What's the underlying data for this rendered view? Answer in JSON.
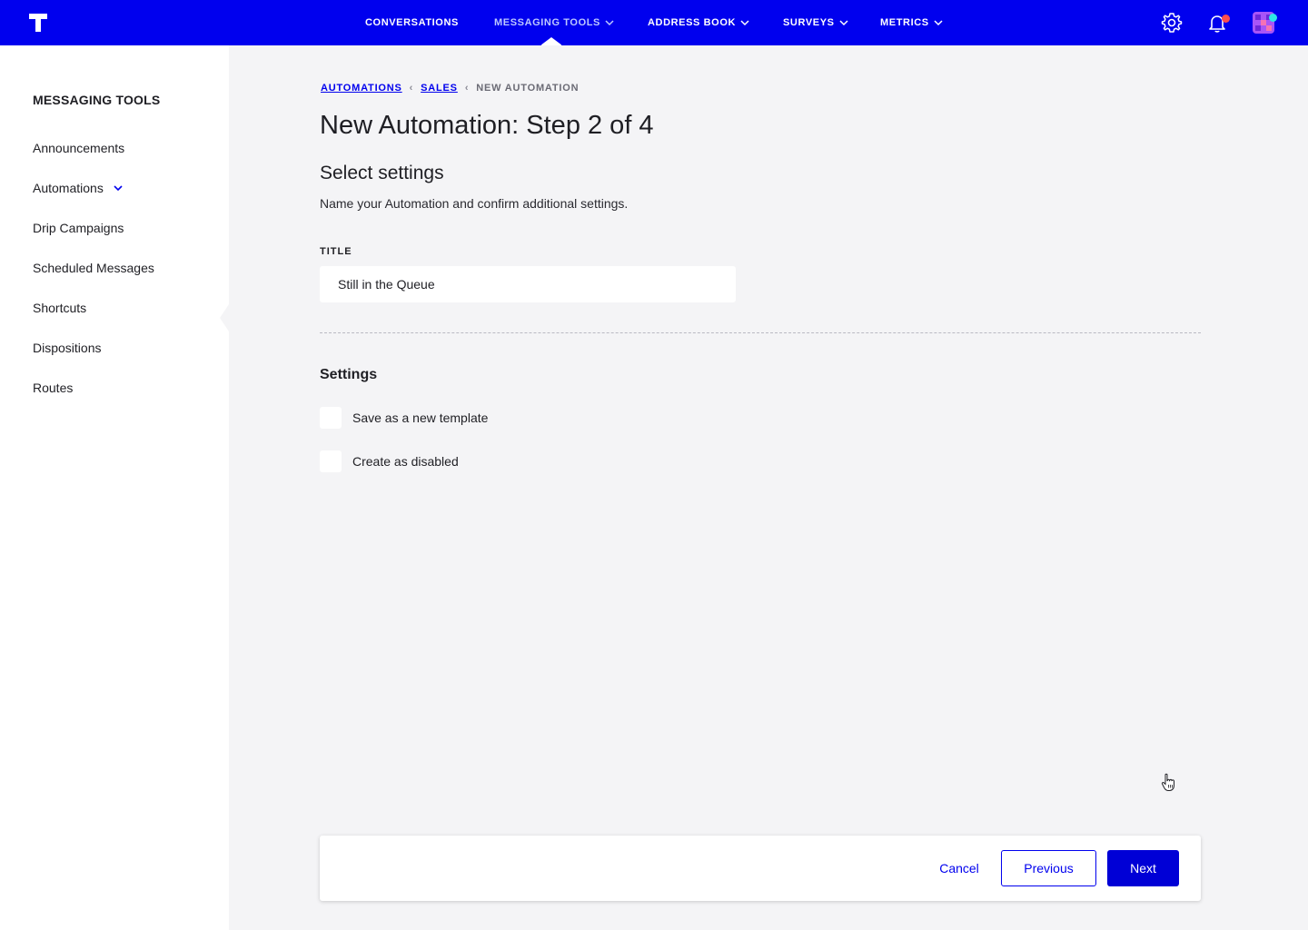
{
  "nav": {
    "items": [
      {
        "label": "CONVERSATIONS",
        "dropdown": false,
        "active": false
      },
      {
        "label": "MESSAGING TOOLS",
        "dropdown": true,
        "active": true
      },
      {
        "label": "ADDRESS BOOK",
        "dropdown": true,
        "active": false
      },
      {
        "label": "SURVEYS",
        "dropdown": true,
        "active": false
      },
      {
        "label": "METRICS",
        "dropdown": true,
        "active": false
      }
    ],
    "icons": [
      "settings-gear-icon",
      "notification-bell-icon",
      "user-avatar-icon"
    ],
    "notification_dot_color": "#ff4d4d",
    "avatar_dot_color": "#2ee6e6"
  },
  "colors": {
    "brand": "#0000ee",
    "active_nav": "#bdc9ff",
    "background": "#f4f4f6"
  },
  "sidebar": {
    "title": "MESSAGING TOOLS",
    "items": [
      {
        "label": "Announcements"
      },
      {
        "label": "Automations",
        "expandable": true
      },
      {
        "label": "Drip Campaigns"
      },
      {
        "label": "Scheduled Messages"
      },
      {
        "label": "Shortcuts"
      },
      {
        "label": "Dispositions"
      },
      {
        "label": "Routes"
      }
    ]
  },
  "breadcrumb": {
    "items": [
      "AUTOMATIONS",
      "SALES"
    ],
    "current": "NEW AUTOMATION"
  },
  "page": {
    "title": "New Automation: Step 2 of 4",
    "section_title": "Select settings",
    "section_desc": "Name your Automation and confirm additional settings."
  },
  "form": {
    "title_label": "TITLE",
    "title_value": "Still in the Queue",
    "settings_title": "Settings",
    "checkboxes": [
      {
        "label": "Save as a new template",
        "checked": false
      },
      {
        "label": "Create as disabled",
        "checked": false
      }
    ]
  },
  "actions": {
    "cancel": "Cancel",
    "previous": "Previous",
    "next": "Next"
  }
}
